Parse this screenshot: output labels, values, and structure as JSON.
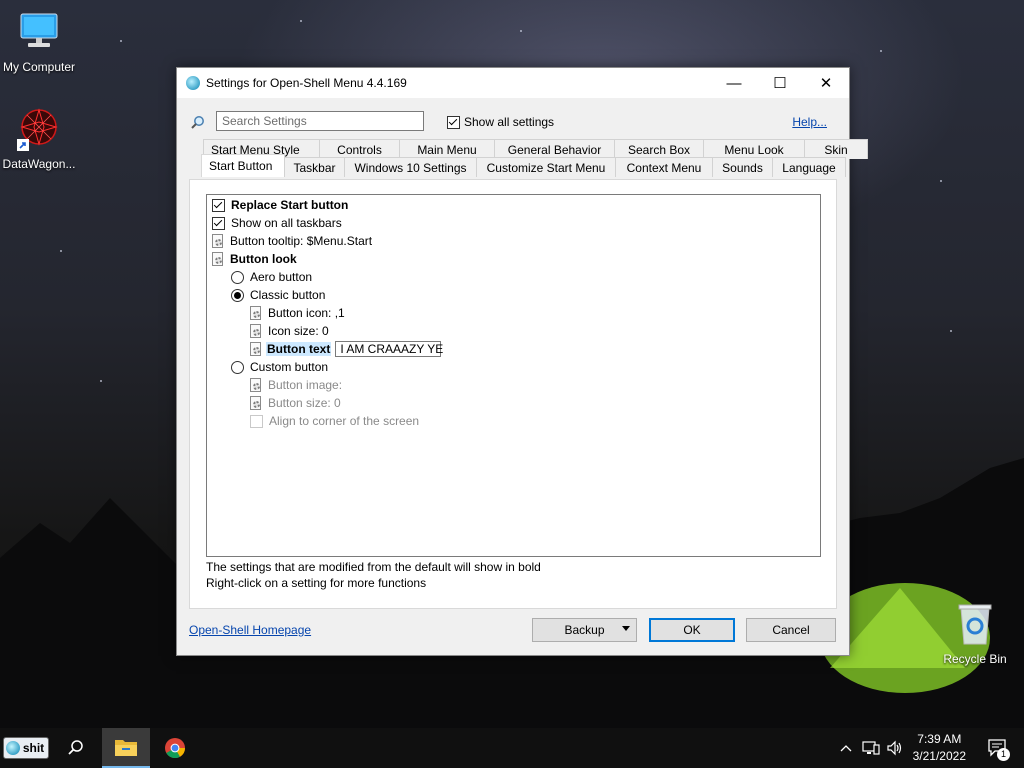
{
  "desktop": {
    "icons": [
      {
        "label": "My Computer"
      },
      {
        "label": "DataWagon..."
      },
      {
        "label": "Recycle Bin"
      }
    ]
  },
  "window": {
    "title": "Settings for Open-Shell Menu 4.4.169",
    "caption": {
      "minimize": "—",
      "maximize": "☐",
      "close": "✕"
    },
    "search": {
      "placeholder": "Search Settings",
      "value": ""
    },
    "show_all": {
      "label": "Show all settings",
      "checked": true
    },
    "help": "Help...",
    "tabs_back": [
      "Start Menu Style",
      "Controls",
      "Main Menu",
      "General Behavior",
      "Search Box",
      "Menu Look",
      "Skin"
    ],
    "tabs_front": [
      "Start Button",
      "Taskbar",
      "Windows 10 Settings",
      "Customize Start Menu",
      "Context Menu",
      "Sounds",
      "Language"
    ],
    "active_tab": "Start Button",
    "settings": [
      {
        "label": "Replace Start button",
        "kind": "checkbox",
        "checked": true,
        "bold": true
      },
      {
        "label": "Show on all taskbars",
        "kind": "checkbox",
        "checked": true
      },
      {
        "label": "Button tooltip: $Menu.Start",
        "kind": "setting"
      },
      {
        "label": "Button look",
        "kind": "setting",
        "bold": true
      },
      {
        "label": "Aero button",
        "kind": "radio",
        "checked": false
      },
      {
        "label": "Classic button",
        "kind": "radio",
        "checked": true
      },
      {
        "label": "Button icon: ,1",
        "kind": "setting"
      },
      {
        "label": "Icon size: 0",
        "kind": "setting"
      },
      {
        "label": "Button text",
        "kind": "setting",
        "bold": true,
        "edit_value": "I AM CRAAAZY YE"
      },
      {
        "label": "Custom button",
        "kind": "radio",
        "checked": false
      },
      {
        "label": "Button image:",
        "kind": "setting",
        "disabled": true
      },
      {
        "label": "Button size: 0",
        "kind": "setting",
        "disabled": true
      },
      {
        "label": "Align to corner of the screen",
        "kind": "checkbox",
        "checked": false,
        "disabled": true
      }
    ],
    "hint1": "The settings that are modified from the default will show in bold",
    "hint2": "Right-click on a setting for more functions",
    "homepage": "Open-Shell Homepage",
    "backup": "Backup",
    "ok": "OK",
    "cancel": "Cancel"
  },
  "taskbar": {
    "start_label": "shit",
    "clock_time": "7:39 AM",
    "clock_date": "3/21/2022",
    "notification_count": "1"
  }
}
